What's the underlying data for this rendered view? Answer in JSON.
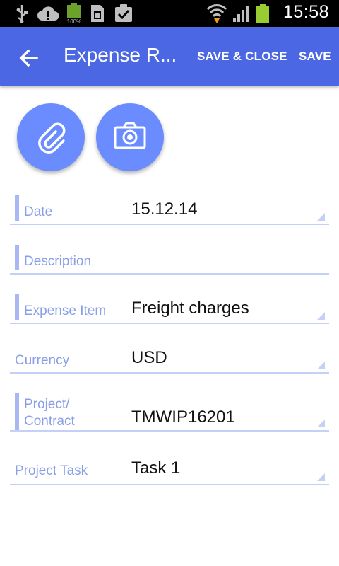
{
  "status_bar": {
    "time": "15:58",
    "icons": [
      "usb-icon",
      "cloud-alert-icon",
      "battery-full-icon",
      "sim-card-icon",
      "task-check-icon",
      "wifi-icon",
      "signal-icon",
      "battery-charging-icon"
    ],
    "battery_badge": "100%"
  },
  "app_bar": {
    "title": "Expense R...",
    "save_close_label": "SAVE & CLOSE",
    "save_label": "SAVE"
  },
  "fabs": [
    "paperclip-icon",
    "camera-icon"
  ],
  "form": {
    "date": {
      "label": "Date",
      "value": "15.12.14",
      "required": true
    },
    "description": {
      "label": "Description",
      "value": "",
      "required": true
    },
    "expense_item": {
      "label": "Expense Item",
      "value": "Freight charges",
      "required": true
    },
    "currency": {
      "label": "Currency",
      "value": "USD",
      "required": false
    },
    "project": {
      "label_line1": "Project/",
      "label_line2": "Contract",
      "value": "TMWIP16201",
      "required": true
    },
    "project_task": {
      "label": "Project Task",
      "value": "Task 1",
      "required": false
    }
  },
  "colors": {
    "app_bar": "#4b67e3",
    "fab": "#6b8cff",
    "label": "#8a9fe8",
    "divider": "#c5d0f7"
  }
}
